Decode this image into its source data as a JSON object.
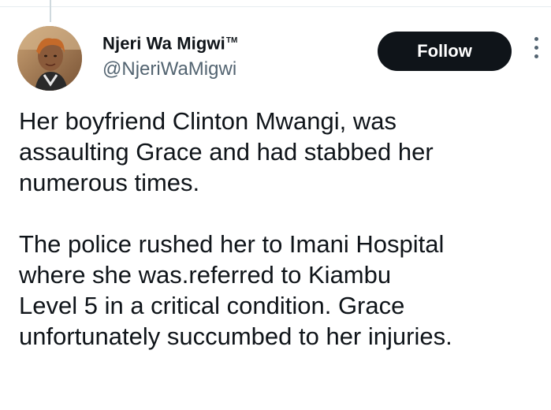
{
  "tweet": {
    "author": {
      "display_name": "Njeri Wa Migwi",
      "trademark": "TM",
      "handle": "@NjeriWaMigwi",
      "avatar": "profile-photo"
    },
    "follow_label": "Follow",
    "more_icon": "more-vertical-icon",
    "paragraphs": [
      {
        "lines": [
          "Her boyfriend Clinton Mwangi, was",
          "assaulting Grace and had stabbed her",
          "numerous times."
        ]
      },
      {
        "lines": [
          "The police rushed her to Imani Hospital",
          "where she was.referred to Kiambu",
          "Level 5 in a critical condition. Grace",
          "unfortunately succumbed to her injuries."
        ]
      }
    ]
  },
  "colors": {
    "text_primary": "#0f1419",
    "text_secondary": "#536471",
    "follow_button_bg": "#0f1419",
    "follow_button_text": "#ffffff"
  }
}
